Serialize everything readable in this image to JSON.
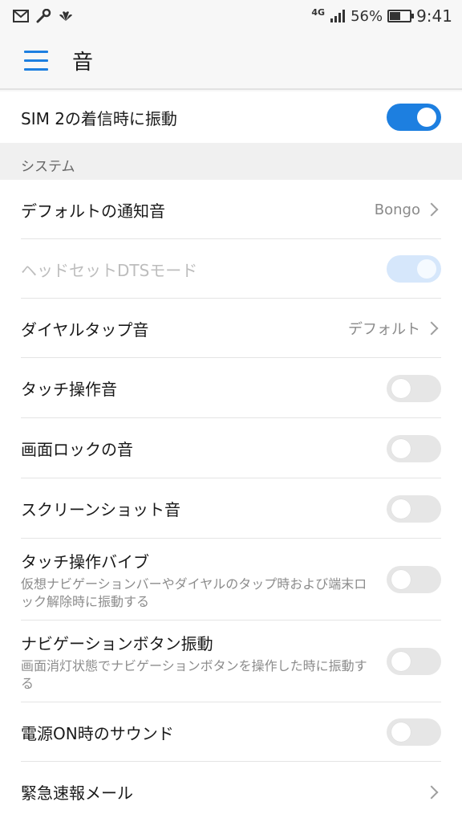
{
  "status_bar": {
    "network": "4G",
    "battery": "56%",
    "battery_level": 0.56,
    "time": "9:41",
    "icons": [
      "gmail-icon",
      "wrench-icon",
      "huawei-icon",
      "signal-icon",
      "battery-icon"
    ]
  },
  "app_bar": {
    "title": "音"
  },
  "top_row": {
    "label": "SIM 2の着信時に振動",
    "state": "on"
  },
  "section": {
    "header": "システム"
  },
  "settings": [
    {
      "label": "デフォルトの通知音",
      "value": "Bongo"
    },
    {
      "label": "ヘッドセットDTSモード",
      "state": "on-disabled"
    },
    {
      "label": "ダイヤルタップ音",
      "value": "デフォルト"
    },
    {
      "label": "タッチ操作音",
      "state": "off"
    },
    {
      "label": "画面ロックの音",
      "state": "off"
    },
    {
      "label": "スクリーンショット音",
      "state": "off"
    },
    {
      "label": "タッチ操作バイブ",
      "sub": "仮想ナビゲーションバーやダイヤルのタップ時および端末ロック解除時に振動する",
      "state": "off"
    },
    {
      "label": "ナビゲーションボタン振動",
      "sub": "画面消灯状態でナビゲーションボタンを操作した時に振動する",
      "state": "off"
    },
    {
      "label": "電源ON時のサウンド",
      "state": "off"
    },
    {
      "label": "緊急速報メール"
    }
  ],
  "colors": {
    "accent": "#1d7fe0",
    "toggle_off": "#e6e6e6",
    "background": "#f7f7f7"
  }
}
